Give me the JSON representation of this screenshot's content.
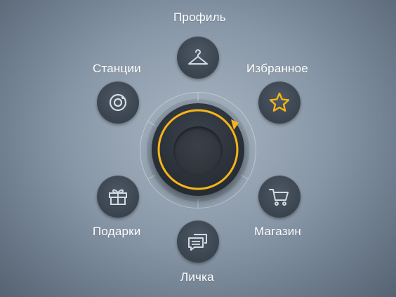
{
  "menu": {
    "items": [
      {
        "id": "profile",
        "label": "Профиль",
        "icon": "hanger-icon"
      },
      {
        "id": "favorites",
        "label": "Избранное",
        "icon": "star-icon",
        "active": true
      },
      {
        "id": "shop",
        "label": "Магазин",
        "icon": "cart-icon"
      },
      {
        "id": "messages",
        "label": "Личка",
        "icon": "chat-bubbles-icon"
      },
      {
        "id": "gifts",
        "label": "Подарки",
        "icon": "gift-icon"
      },
      {
        "id": "stations",
        "label": "Станции",
        "icon": "radio-station-icon"
      }
    ]
  },
  "colors": {
    "accent": "#f5b418",
    "icon": "#d2dbe3",
    "button": "#3b4550",
    "knob": "#2a3038"
  }
}
